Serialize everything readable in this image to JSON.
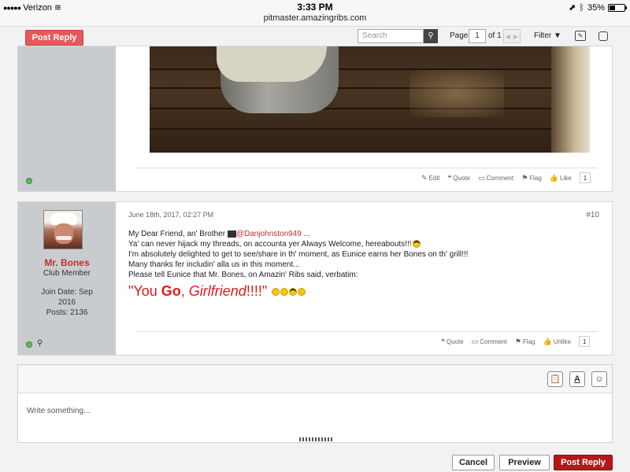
{
  "status_bar": {
    "signal": "●●●●●",
    "carrier": "Verizon",
    "time": "3:33 PM",
    "url": "pitmaster.amazingribs.com",
    "battery": "35%"
  },
  "toolbar": {
    "post_reply": "Post Reply",
    "search_placeholder": "Search",
    "page_label": "Page",
    "page_value": "1",
    "page_of": "of 1",
    "filter": "Filter"
  },
  "post1": {
    "actions": {
      "edit": "Edit",
      "quote": "Quote",
      "comment": "Comment",
      "flag": "Flag",
      "like": "Like",
      "like_count": "1"
    }
  },
  "post2": {
    "username": "Mr. Bones",
    "user_title": "Club Member",
    "join_date": "Join Date: Sep 2016",
    "posts": "Posts: 2136",
    "date": "June 18th, 2017, 02:27 PM",
    "number": "#10",
    "line1_pre": "My Dear Friend, an' Brother",
    "mention": "@Danjohnston949",
    "line1_post": "...",
    "line2": "Ya' can never hijack my threads, on accounta yer Always Welcome, hereabouts!!!",
    "line3": "I'm absolutely delighted to get to see/share in th' moment, as Eunice earns her Bones on th' grill!!!",
    "line4": "Many thanks fer includin' alla us in this moment...",
    "line5": "Please tell Eunice that Mr. Bones, on Amazin' Ribs said, verbatim:",
    "big_1": "\"You ",
    "big_go": "Go",
    "big_2": ", ",
    "big_girl": "Girlfriend",
    "big_3": "!!!!\"",
    "actions": {
      "quote": "Quote",
      "comment": "Comment",
      "flag": "Flag",
      "unlike": "Unlike",
      "like_count": "1"
    }
  },
  "editor": {
    "placeholder": "Write something..."
  },
  "buttons": {
    "cancel": "Cancel",
    "preview": "Preview",
    "post_reply": "Post Reply"
  }
}
